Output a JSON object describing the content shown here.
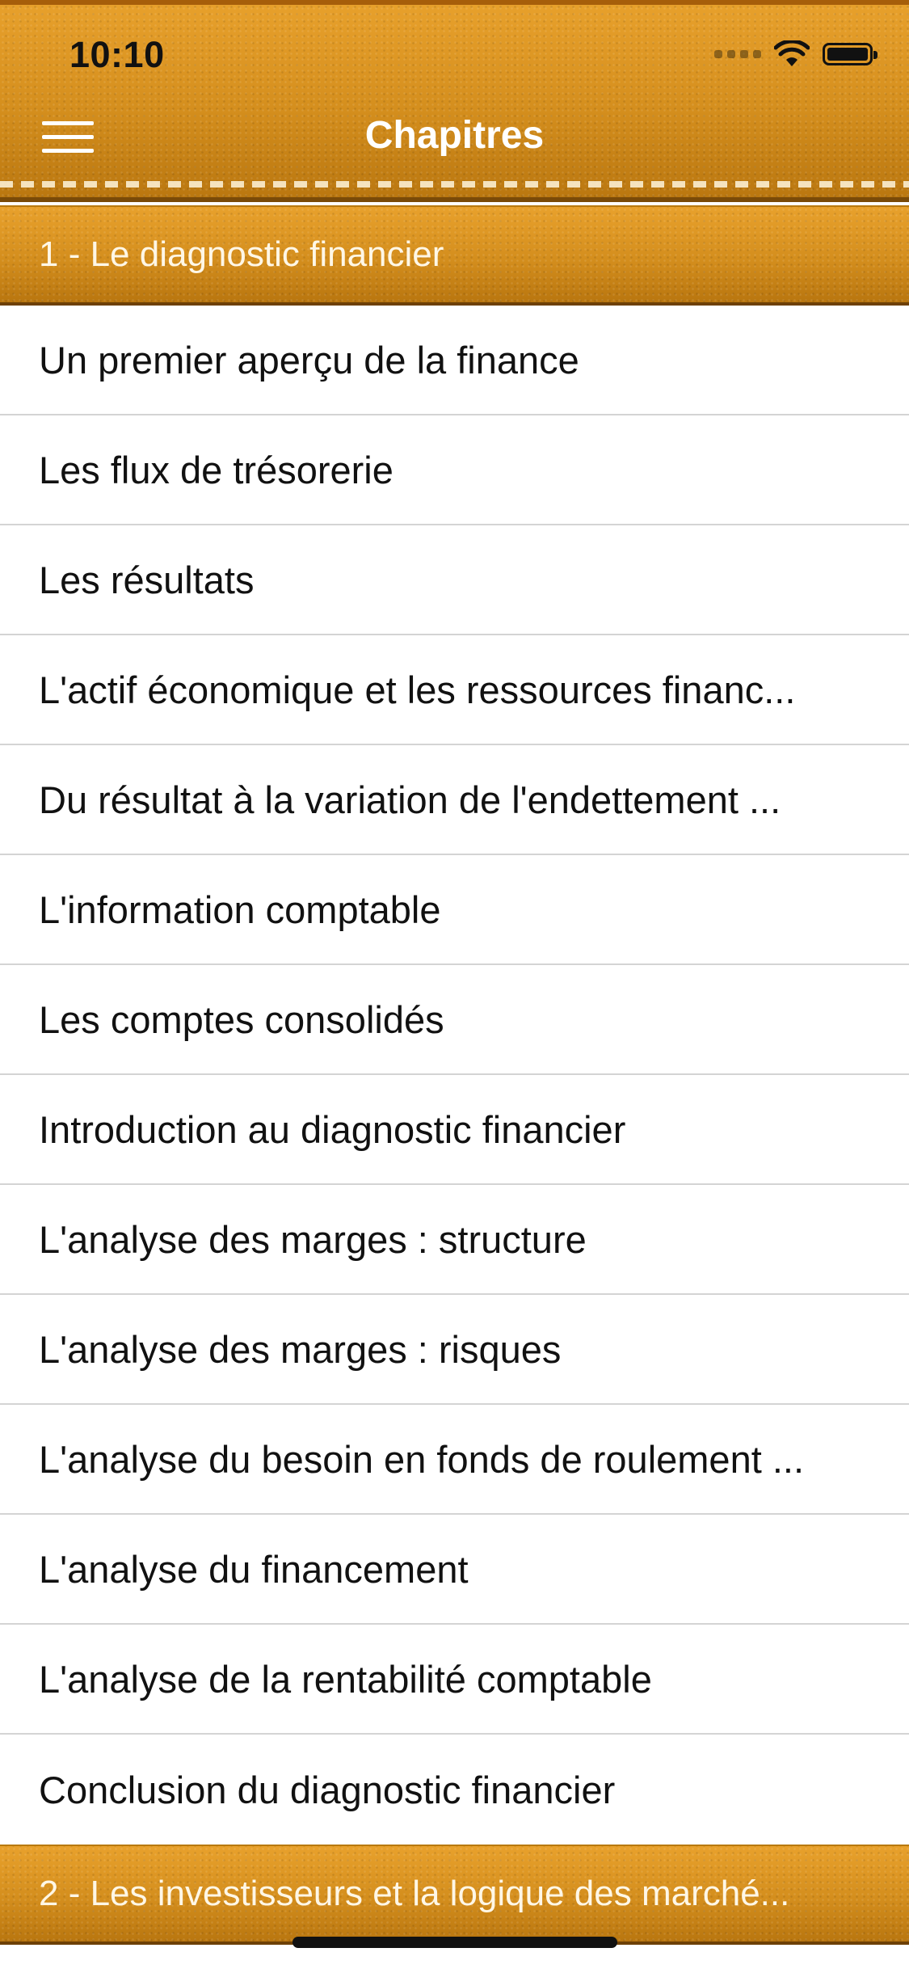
{
  "status_bar": {
    "time": "10:10"
  },
  "nav": {
    "title": "Chapitres"
  },
  "sections": [
    {
      "label": "1 - Le diagnostic financier",
      "items": [
        "Un premier aperçu de la finance",
        "Les flux de trésorerie",
        "Les résultats",
        "L'actif économique et les ressources financ...",
        "Du résultat à la variation de l'endettement ...",
        "L'information comptable",
        "Les comptes consolidés",
        "Introduction au diagnostic financier",
        "L'analyse des marges : structure",
        "L'analyse des marges : risques",
        "L'analyse du besoin en fonds de roulement ...",
        "L'analyse du financement",
        "L'analyse de la rentabilité comptable",
        "Conclusion du diagnostic financier"
      ]
    },
    {
      "label": "2 - Les investisseurs et la logique des marché..."
    }
  ],
  "colors": {
    "leather": "#d4901f",
    "header_text": "#ffffff",
    "row_text": "#111111",
    "separator": "#d4d4d4"
  }
}
